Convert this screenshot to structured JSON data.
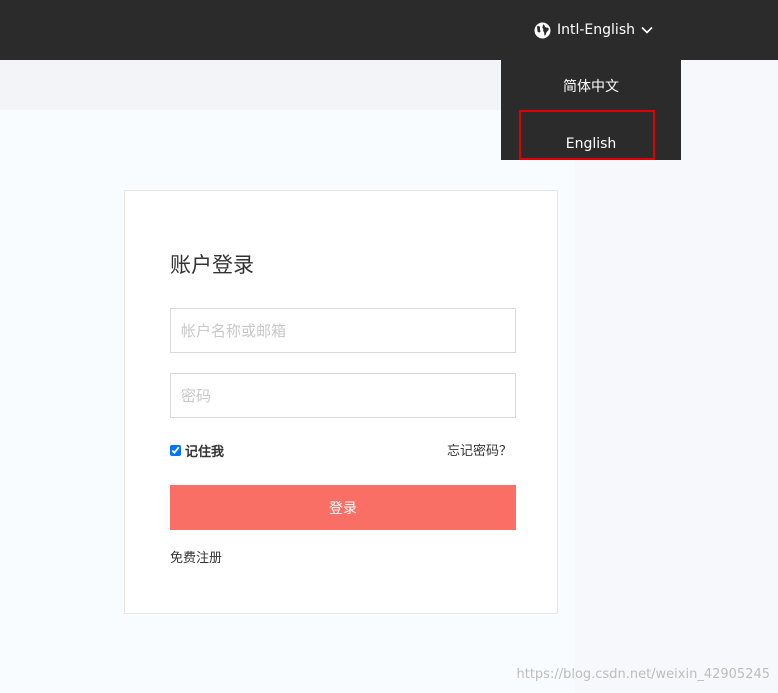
{
  "header": {
    "language_toggle_label": "Intl-English",
    "icons": {
      "globe": "globe-icon",
      "chevron": "chevron-down-icon"
    }
  },
  "language_menu": {
    "items": [
      {
        "label": "简体中文"
      },
      {
        "label": "English"
      }
    ],
    "highlighted_item": "English",
    "highlight_color": "#e00000"
  },
  "login": {
    "title": "账户登录",
    "username_placeholder": "帐户名称或邮箱",
    "password_placeholder": "密码",
    "remember_label": "记住我",
    "remember_checked": true,
    "forgot_label": "忘记密码？",
    "submit_label": "登录",
    "register_label": "免费注册"
  },
  "colors": {
    "header_bg": "#2b2b2b",
    "accent": "#fa6f65"
  },
  "watermark": "https://blog.csdn.net/weixin_42905245"
}
